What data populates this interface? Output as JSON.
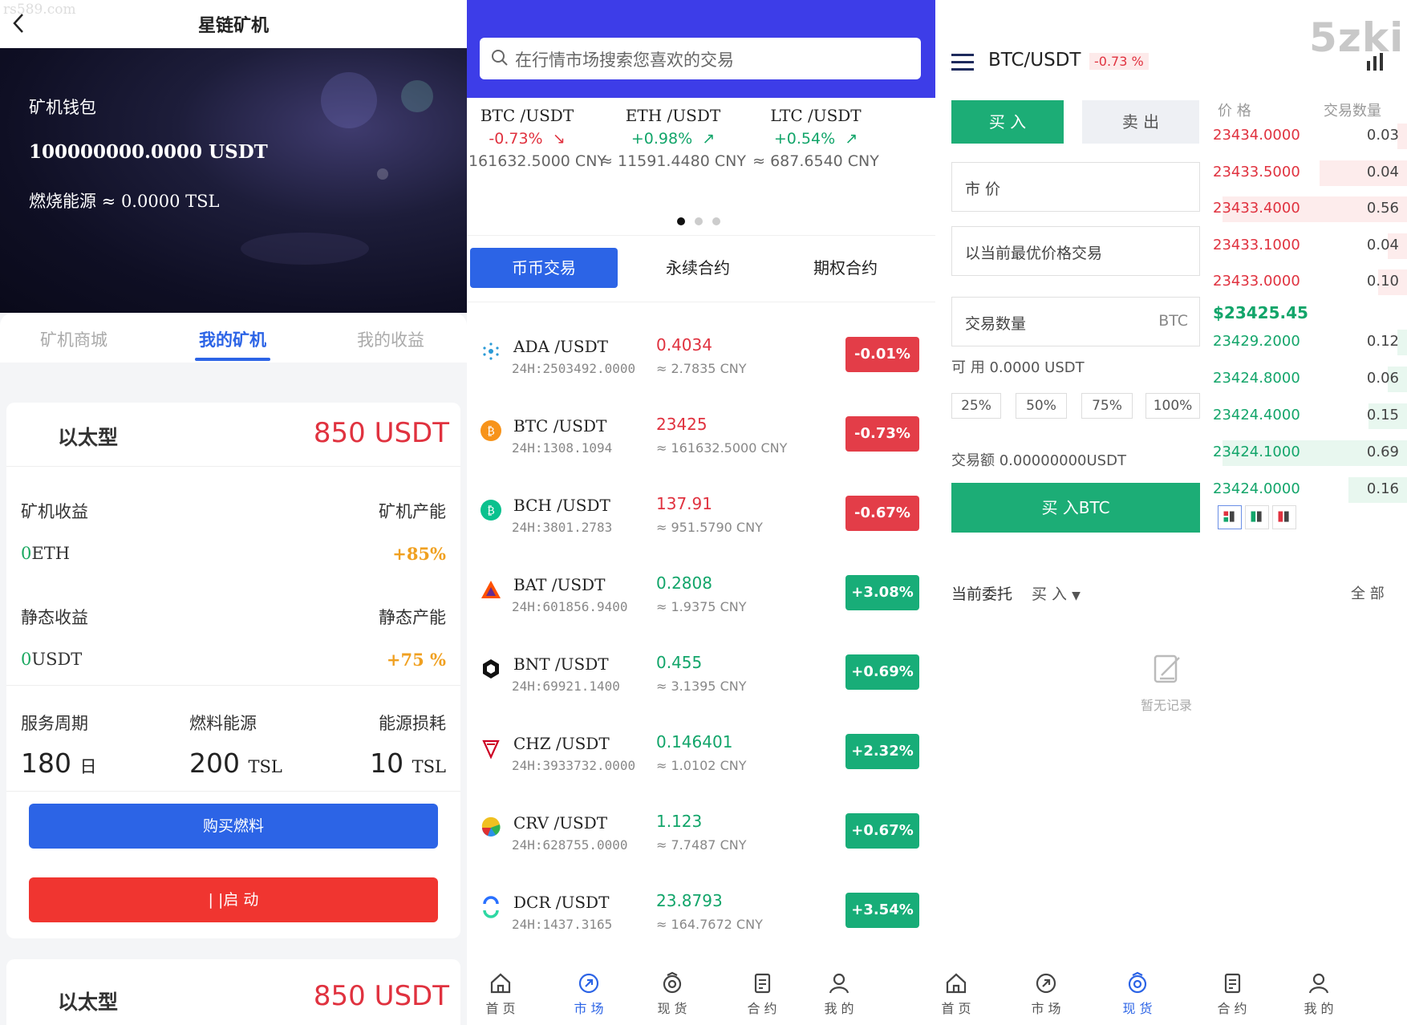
{
  "watermark": "rs589.com",
  "mining": {
    "title": "星链矿机",
    "wallet_label": "矿机钱包",
    "wallet_amount": "100000000.0000 USDT",
    "burn_energy": "燃烧能源 ≈ 0.0000 TSL",
    "tabs": [
      "矿机商城",
      "我的矿机",
      "我的收益"
    ],
    "active_tab": 1,
    "cards": [
      {
        "type": "以太型",
        "price": "850 USDT",
        "earnings_label": "矿机收益",
        "capacity_label": "矿机产能",
        "earnings_value": "0",
        "earnings_unit": "ETH",
        "capacity_value": "+85%",
        "static_label": "静态收益",
        "static_capacity_label": "静态产能",
        "static_value": "0",
        "static_unit": "USDT",
        "static_capacity_value": "+75 %",
        "period_label": "服务周期",
        "fuel_label": "燃料能源",
        "loss_label": "能源损耗",
        "period_value": "180",
        "period_unit": "日",
        "fuel_value": "200",
        "fuel_unit": "TSL",
        "loss_value": "10",
        "loss_unit": "TSL",
        "buy_fuel_label": "购买燃料",
        "start_label": "| |启 动"
      },
      {
        "type": "以太型",
        "price": "850 USDT"
      }
    ]
  },
  "market": {
    "search_placeholder": "在行情市场搜索您喜欢的交易",
    "tickers": [
      {
        "pair": "BTC /USDT",
        "change": "-0.73%",
        "arrow": "↘",
        "cny": "≈ 161632.5000 CNY",
        "dir": "down"
      },
      {
        "pair": "ETH /USDT",
        "change": "+0.98%",
        "arrow": "↗",
        "cny": "≈ 11591.4480 CNY",
        "dir": "up"
      },
      {
        "pair": "LTC /USDT",
        "change": "+0.54%",
        "arrow": "↗",
        "cny": "≈ 687.6540 CNY",
        "dir": "up"
      }
    ],
    "segments": [
      "币币交易",
      "永续合约",
      "期权合约"
    ],
    "rows": [
      {
        "pair": "ADA /USDT",
        "vol": "24H:2503492.0000",
        "price": "0.4034",
        "cny": "≈ 2.7835 CNY",
        "change": "-0.01%",
        "dir": "down",
        "icon": "ada-icon",
        "color": "#2a9ad6"
      },
      {
        "pair": "BTC /USDT",
        "vol": "24H:1308.1094",
        "price": "23425",
        "cny": "≈ 161632.5000 CNY",
        "change": "-0.73%",
        "dir": "down",
        "icon": "btc-icon",
        "color": "#f7931a"
      },
      {
        "pair": "BCH /USDT",
        "vol": "24H:3801.2783",
        "price": "137.91",
        "cny": "≈ 951.5790 CNY",
        "change": "-0.67%",
        "dir": "down",
        "icon": "bch-icon",
        "color": "#0ac18e"
      },
      {
        "pair": "BAT /USDT",
        "vol": "24H:601856.9400",
        "price": "0.2808",
        "cny": "≈ 1.9375 CNY",
        "change": "+3.08%",
        "dir": "up",
        "icon": "bat-icon",
        "color": "#ff5000"
      },
      {
        "pair": "BNT /USDT",
        "vol": "24H:69921.1400",
        "price": "0.455",
        "cny": "≈ 3.1395 CNY",
        "change": "+0.69%",
        "dir": "up",
        "icon": "bnt-icon",
        "color": "#111111"
      },
      {
        "pair": "CHZ /USDT",
        "vol": "24H:3933732.0000",
        "price": "0.146401",
        "cny": "≈ 1.0102 CNY",
        "change": "+2.32%",
        "dir": "up",
        "icon": "chz-icon",
        "color": "#cd0124"
      },
      {
        "pair": "CRV /USDT",
        "vol": "24H:628755.0000",
        "price": "1.123",
        "cny": "≈ 7.7487 CNY",
        "change": "+0.67%",
        "dir": "up",
        "icon": "crv-icon",
        "color": "#e8a020"
      },
      {
        "pair": "DCR /USDT",
        "vol": "24H:1437.3165",
        "price": "23.8793",
        "cny": "≈ 164.7672 CNY",
        "change": "+3.54%",
        "dir": "up",
        "icon": "dcr-icon",
        "color": "#2970ff"
      }
    ]
  },
  "trade": {
    "pair": "BTC/USDT",
    "change": "-0.73 %",
    "logo": "5zki",
    "buy_tab": "买 入",
    "sell_tab": "卖 出",
    "price_type": "市 价",
    "best_price": "以当前最优价格交易",
    "qty_label": "交易数量",
    "qty_unit": "BTC",
    "available": "可 用 0.0000 USDT",
    "percents": [
      "25%",
      "50%",
      "75%",
      "100%"
    ],
    "amount": "交易额 0.00000000USDT",
    "buy_button": "买 入BTC",
    "ob_header_price": "价 格",
    "ob_header_qty": "交易数量",
    "asks": [
      {
        "price": "23434.0000",
        "qty": "0.03",
        "depth": 0.05
      },
      {
        "price": "23433.5000",
        "qty": "0.04",
        "depth": 0.45
      },
      {
        "price": "23433.4000",
        "qty": "0.56",
        "depth": 0.95
      },
      {
        "price": "23433.1000",
        "qty": "0.04",
        "depth": 0.1
      },
      {
        "price": "23433.0000",
        "qty": "0.10",
        "depth": 0.15
      }
    ],
    "last_price": "$23425.45",
    "bids": [
      {
        "price": "23429.2000",
        "qty": "0.12",
        "depth": 0.05
      },
      {
        "price": "23424.8000",
        "qty": "0.06",
        "depth": 0.1
      },
      {
        "price": "23424.4000",
        "qty": "0.15",
        "depth": 0.2
      },
      {
        "price": "23424.1000",
        "qty": "0.69",
        "depth": 0.95
      },
      {
        "price": "23424.0000",
        "qty": "0.16",
        "depth": 0.3
      }
    ],
    "orders_label": "当前委托",
    "orders_filter": "买 入",
    "orders_all": "全 部",
    "empty_label": "暂无记录"
  },
  "tabbar": {
    "items": [
      "首 页",
      "市 场",
      "现 货",
      "合 约",
      "我 的"
    ],
    "market_active": 1,
    "trade_active": 2
  },
  "colors": {
    "blue": "#2c64e6",
    "red": "#e0323f",
    "green": "#12a56a",
    "buy_green": "#1cad76"
  }
}
